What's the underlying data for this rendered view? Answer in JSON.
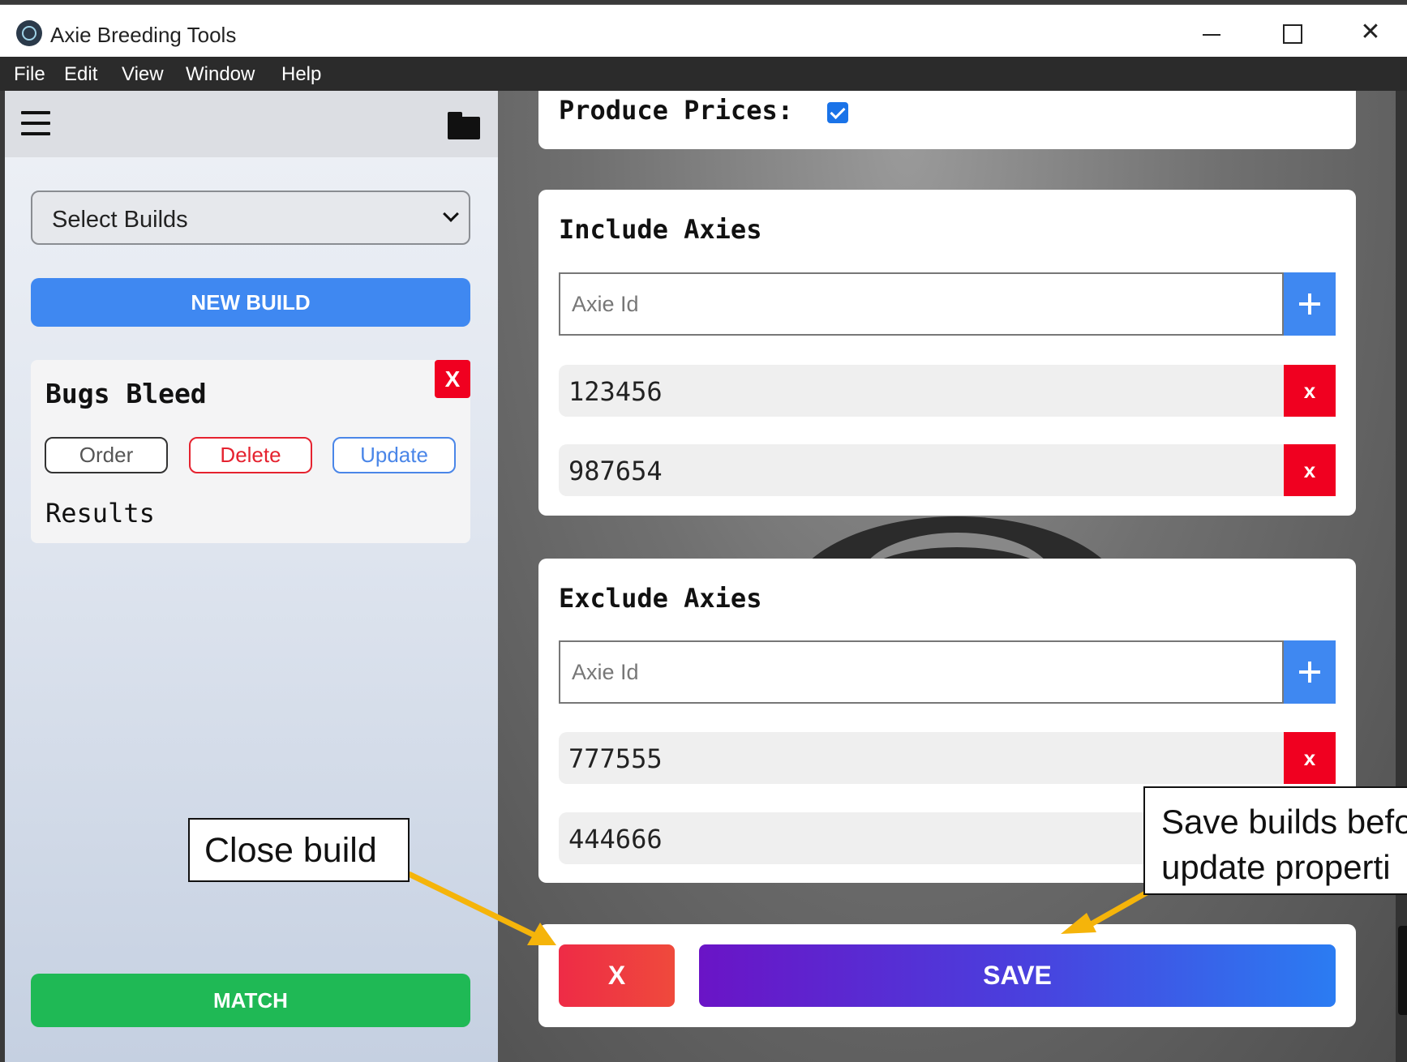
{
  "window": {
    "title": "Axie Breeding Tools",
    "controls": {
      "minimize": "minimize-icon",
      "maximize": "maximize-icon",
      "close": "✕"
    }
  },
  "menu": [
    "File",
    "Edit",
    "View",
    "Window",
    "Help"
  ],
  "sidebar": {
    "icons": {
      "menu": "hamburger-icon",
      "open": "folder-icon"
    },
    "select_builds": "Select Builds",
    "new_build": "NEW BUILD",
    "build": {
      "name": "Bugs Bleed",
      "close": "X",
      "order": "Order",
      "delete": "Delete",
      "update": "Update",
      "results": "Results"
    },
    "match": "MATCH"
  },
  "main": {
    "produce_prices": {
      "label": "Produce Prices:",
      "checked": true
    },
    "include": {
      "title": "Include Axies",
      "placeholder": "Axie Id",
      "ids": [
        "123456",
        "987654"
      ],
      "remove_label": "x"
    },
    "exclude": {
      "title": "Exclude Axies",
      "placeholder": "Axie Id",
      "ids": [
        "777555",
        "444666"
      ],
      "remove_label": "x"
    },
    "actions": {
      "cancel": "X",
      "save": "SAVE"
    }
  },
  "callouts": {
    "close_build": "Close build",
    "save_line1": "Save builds befo",
    "save_line2": "update properti"
  },
  "colors": {
    "accent_blue": "#3f88f1",
    "danger_red": "#f00020",
    "match_green": "#1fb955",
    "arrow": "#f5b40a"
  }
}
